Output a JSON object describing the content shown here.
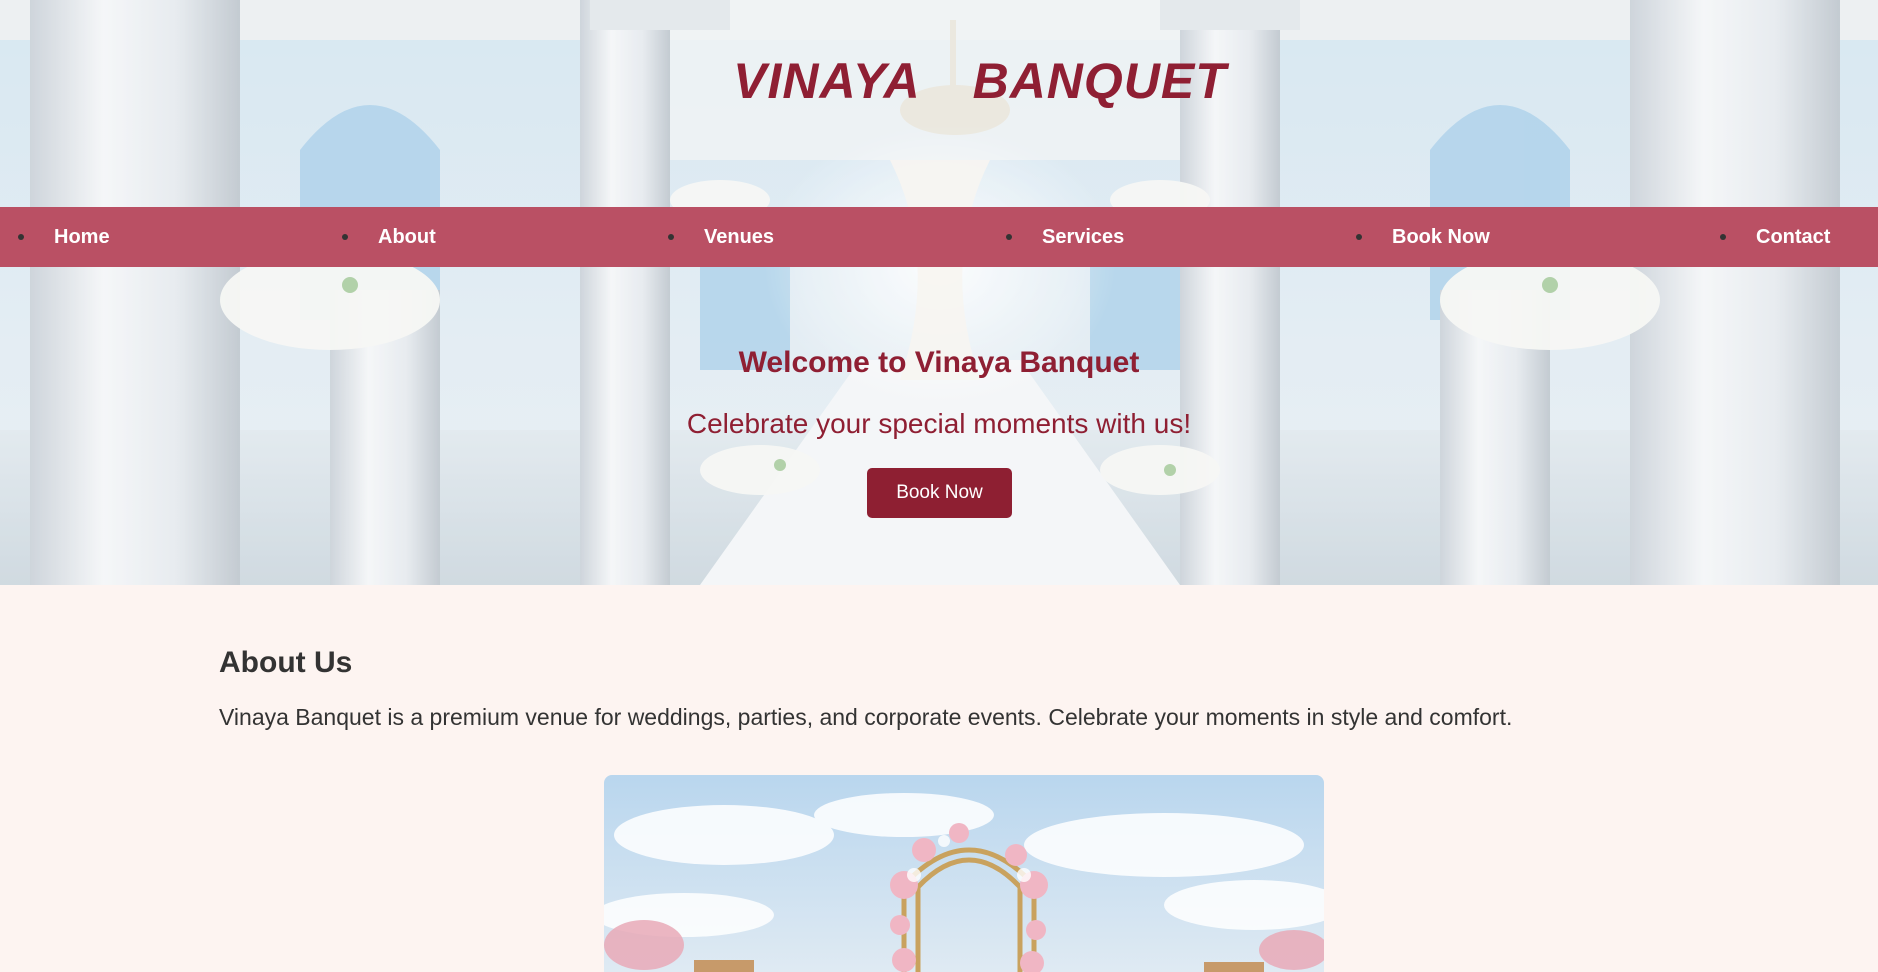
{
  "site": {
    "title": "VINAYA  BANQUET"
  },
  "nav": {
    "items": [
      {
        "label": "Home"
      },
      {
        "label": "About"
      },
      {
        "label": "Venues"
      },
      {
        "label": "Services"
      },
      {
        "label": "Book Now"
      },
      {
        "label": "Contact"
      }
    ]
  },
  "hero": {
    "heading": "Welcome to Vinaya Banquet",
    "subheading": "Celebrate your special moments with us!",
    "cta_label": "Book Now"
  },
  "about": {
    "title": "About Us",
    "text": "Vinaya Banquet is a premium venue for weddings, parties, and corporate events. Celebrate your moments in style and comfort."
  },
  "colors": {
    "brand": "#8f1f33",
    "nav_bg": "#ba5064",
    "page_bg": "#fdf4f1",
    "button_bg": "#8e1f32"
  }
}
